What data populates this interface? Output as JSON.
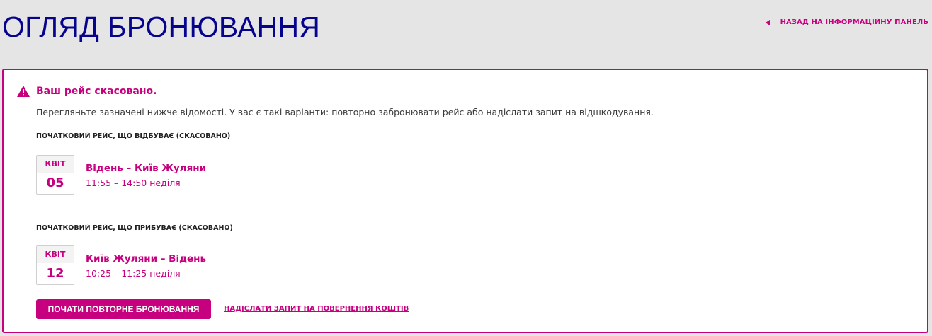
{
  "header": {
    "title": "ОГЛЯД БРОНЮВАННЯ",
    "back_link": "НАЗАД НА ІНФОРМАЦІЙНУ ПАНЕЛЬ"
  },
  "alert": {
    "title": "Ваш рейс скасовано.",
    "message": "Перегляньте зазначені нижче відомості. У вас є такі варіанти: повторно забронювати рейс або надіслати запит на відшкодування."
  },
  "flights": [
    {
      "section_label": "ПОЧАТКОВИЙ РЕЙС, ЩО ВІДБУВАЄ (СКАСОВАНО)",
      "month": "КВІТ",
      "day": "05",
      "route": "Відень – Київ Жуляни",
      "times": "11:55 – 14:50 неділя"
    },
    {
      "section_label": "ПОЧАТКОВИЙ РЕЙС, ЩО ПРИБУВАЄ (СКАСОВАНО)",
      "month": "КВІТ",
      "day": "12",
      "route": "Київ Жуляни – Відень",
      "times": "10:25 – 11:25 неділя"
    }
  ],
  "actions": {
    "rebook": "ПОЧАТИ ПОВТОРНЕ БРОНЮВАННЯ",
    "refund": "НАДІСЛАТИ ЗАПИТ НА ПОВЕРНЕННЯ КОШТІВ"
  },
  "colors": {
    "brand_magenta": "#c6007e",
    "title_blue": "#06038d",
    "background": "#e6e5e6"
  },
  "icons": {
    "alert": "warning-triangle-icon",
    "back": "caret-left-icon"
  }
}
